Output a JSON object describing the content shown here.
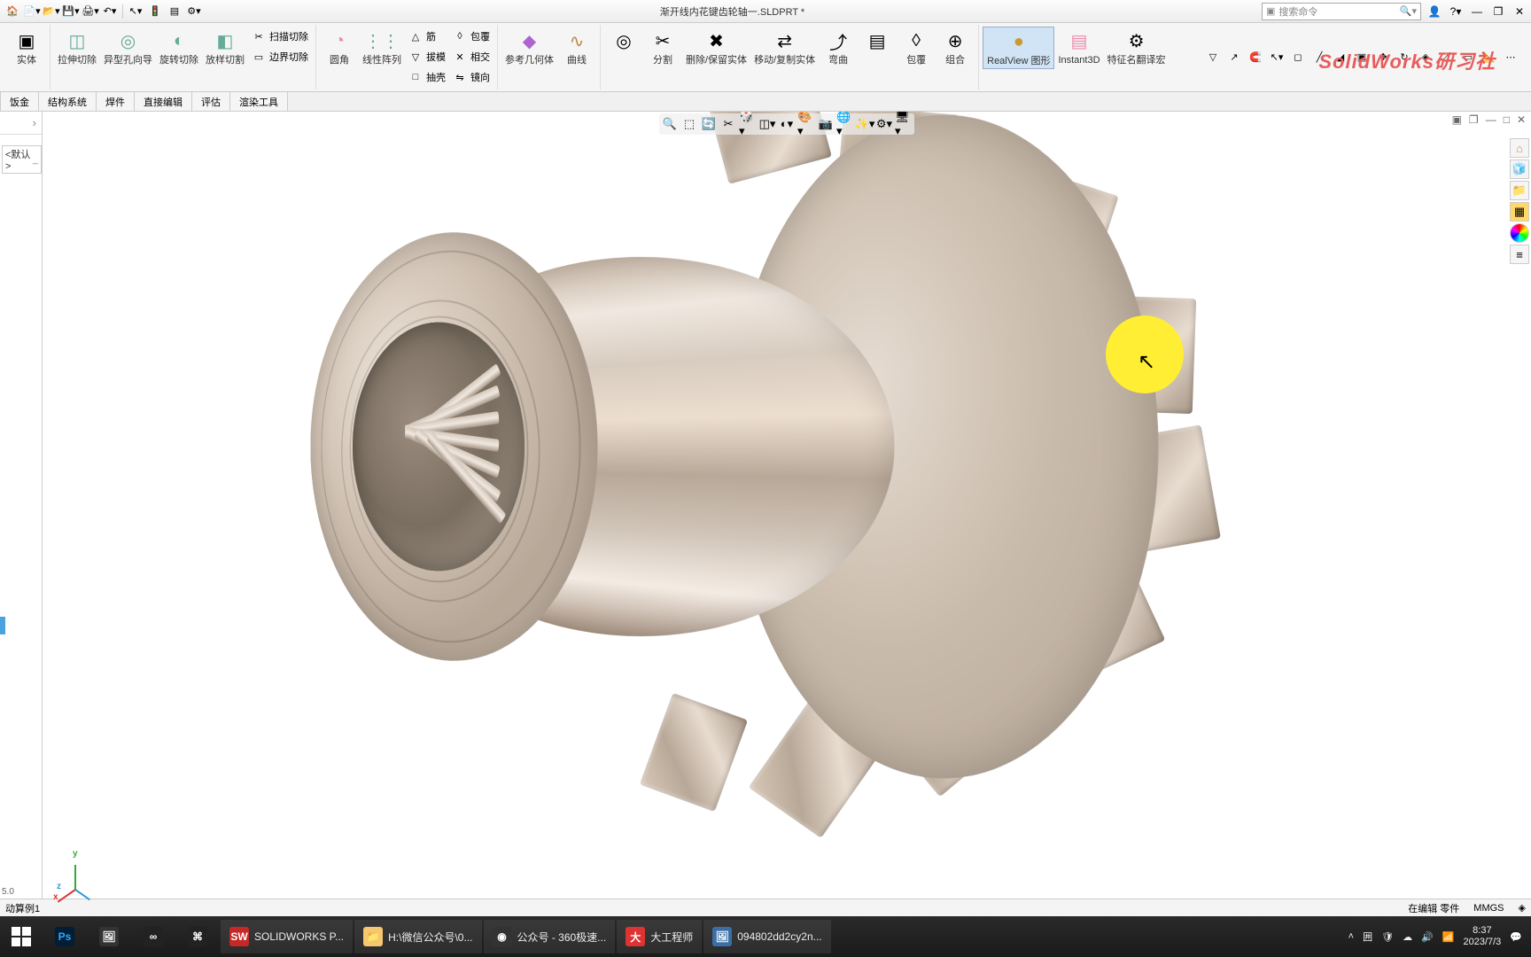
{
  "title_bar": {
    "doc_title": "渐开线内花键齿轮轴一.SLDPRT *",
    "search_placeholder": "搜索命令"
  },
  "ribbon": {
    "g1": [
      {
        "label": "实体",
        "icon": "▣"
      }
    ],
    "g2": [
      {
        "label": "拉伸切除",
        "icon": "◫"
      },
      {
        "label": "异型孔向导",
        "icon": "◎"
      },
      {
        "label": "旋转切除",
        "icon": "◐"
      },
      {
        "label": "放样切割",
        "icon": "◧"
      }
    ],
    "g2s": [
      {
        "label": "扫描切除",
        "icon": "✂"
      },
      {
        "label": "边界切除",
        "icon": "▭"
      }
    ],
    "g3": [
      {
        "label": "圆角",
        "icon": "◔"
      },
      {
        "label": "线性阵列",
        "icon": "⋮⋮"
      }
    ],
    "g3s": [
      {
        "label": "筋",
        "icon": "△"
      },
      {
        "label": "拔模",
        "icon": "▽"
      },
      {
        "label": "抽壳",
        "icon": "□"
      },
      {
        "label": "包覆",
        "icon": "◊"
      },
      {
        "label": "相交",
        "icon": "✕"
      },
      {
        "label": "镜向",
        "icon": "⇋"
      }
    ],
    "g4": [
      {
        "label": "参考几何体",
        "icon": "◆"
      },
      {
        "label": "曲线",
        "icon": "∿"
      }
    ],
    "g5": [
      {
        "label": "",
        "icon": "◎"
      },
      {
        "label": "分割",
        "icon": "✂"
      },
      {
        "label": "删除/保留实体",
        "icon": "✖"
      },
      {
        "label": "移动/复制实体",
        "icon": "⇄"
      },
      {
        "label": "弯曲",
        "icon": "⤴"
      },
      {
        "label": "",
        "icon": "▤"
      },
      {
        "label": "包覆",
        "icon": "◊"
      },
      {
        "label": "组合",
        "icon": "⊕"
      }
    ],
    "g6": [
      {
        "label": "RealView 图形",
        "icon": "●",
        "active": true
      },
      {
        "label": "Instant3D",
        "icon": "▤"
      },
      {
        "label": "特征名翻译宏",
        "icon": "⚙"
      }
    ]
  },
  "secondary_tabs": [
    "饭金",
    "结构系统",
    "焊件",
    "直接编辑",
    "评估",
    "渲染工具"
  ],
  "config_tag": "<默认>",
  "status": {
    "left": "动算例1",
    "ver": "5.0",
    "edit": "在编辑 零件",
    "units": "MMGS"
  },
  "taskbar": {
    "apps": [
      {
        "label": "",
        "icon": "Ps",
        "color": "#001e36",
        "fg": "#31a8ff",
        "iconic": true
      },
      {
        "label": "",
        "icon": "🖼",
        "color": "#333",
        "iconic": true
      },
      {
        "label": "",
        "icon": "∞",
        "color": "#222",
        "iconic": true
      },
      {
        "label": "",
        "icon": "⌘",
        "color": "#222",
        "iconic": true
      },
      {
        "label": "SOLIDWORKS P...",
        "icon": "SW",
        "color": "#c62828",
        "fg": "#fff"
      },
      {
        "label": "H:\\微信公众号\\0...",
        "icon": "📁",
        "color": "#f5c76e"
      },
      {
        "label": "公众号 - 360极速...",
        "icon": "◉",
        "color": "#333"
      },
      {
        "label": "大工程师",
        "icon": "大",
        "color": "#d33",
        "fg": "#fff"
      },
      {
        "label": "094802dd2cy2n...",
        "icon": "🖼",
        "color": "#3a6ea5"
      }
    ],
    "time": "8:37",
    "date": "2023/7/3"
  },
  "watermark": "SolidWorks研习社",
  "triad": {
    "x": "x",
    "y": "y",
    "z": "z"
  }
}
